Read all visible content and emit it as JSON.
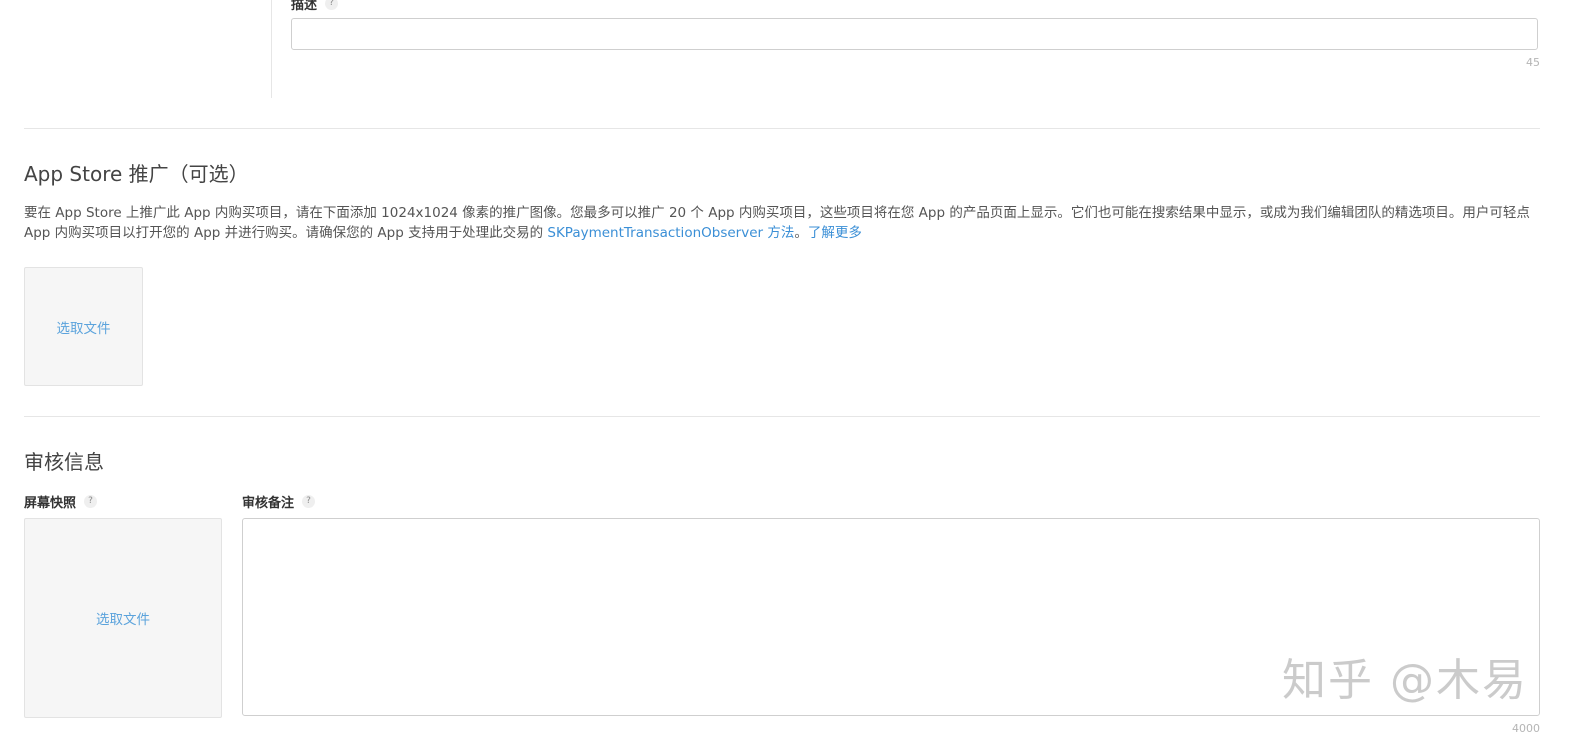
{
  "description": {
    "label": "描述",
    "help": "?",
    "value": "",
    "counter": "45"
  },
  "promotion": {
    "title": "App Store 推广（可选）",
    "text_before_link": "要在 App Store 上推广此 App 内购买项目，请在下面添加 1024x1024 像素的推广图像。您最多可以推广 20 个 App 内购买项目，这些项目将在您 App 的产品页面上显示。它们也可能在搜索结果中显示，或成为我们编辑团队的精选项目。用户可轻点 App 内购买项目以打开您的 App 并进行购买。请确保您的 App 支持用于处理此交易的 ",
    "link_method": "SKPaymentTransactionObserver 方法",
    "separator": "。",
    "link_learn_more": "了解更多",
    "choose_file": "选取文件"
  },
  "review": {
    "title": "审核信息",
    "screenshot_label": "屏幕快照",
    "screenshot_help": "?",
    "choose_file": "选取文件",
    "notes_label": "审核备注",
    "notes_help": "?",
    "notes_value": "",
    "notes_counter": "4000"
  },
  "watermark": "知乎 @木易"
}
